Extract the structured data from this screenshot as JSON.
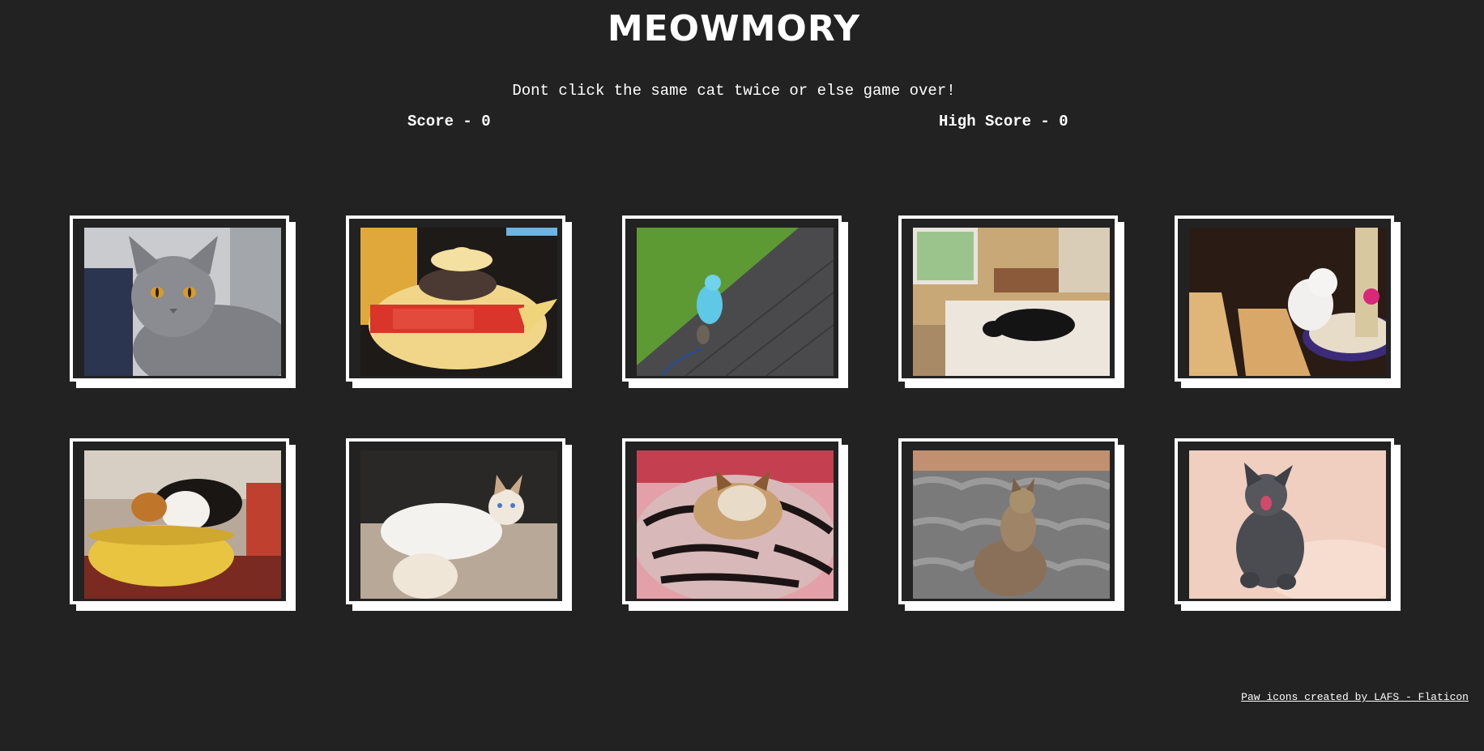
{
  "header": {
    "title": "MEOWMORY",
    "instructions": "Dont click the same cat twice or else game over!"
  },
  "scores": {
    "score_label": "Score - 0",
    "score": 0,
    "high_score_label": "High Score - 0",
    "high_score": 0
  },
  "cards": [
    {
      "subject": "grey cat with orange eyes"
    },
    {
      "subject": "kitten in a teapot"
    },
    {
      "subject": "cat in blue hoodie on a deck"
    },
    {
      "subject": "black cat lying on a bed"
    },
    {
      "subject": "white kitten with a scratching post"
    },
    {
      "subject": "kitten in a yellow bowl"
    },
    {
      "subject": "white siamese cat on a cat tree"
    },
    {
      "subject": "cat sleeping in a zebra bed"
    },
    {
      "subject": "tabby cat on a roof"
    },
    {
      "subject": "fluffy grey kitten yawning"
    }
  ],
  "footer": {
    "credit": "Paw icons created by LAFS - Flaticon"
  },
  "colors": {
    "background": "#222222",
    "text": "#ffffff",
    "card_border": "#ffffff"
  }
}
